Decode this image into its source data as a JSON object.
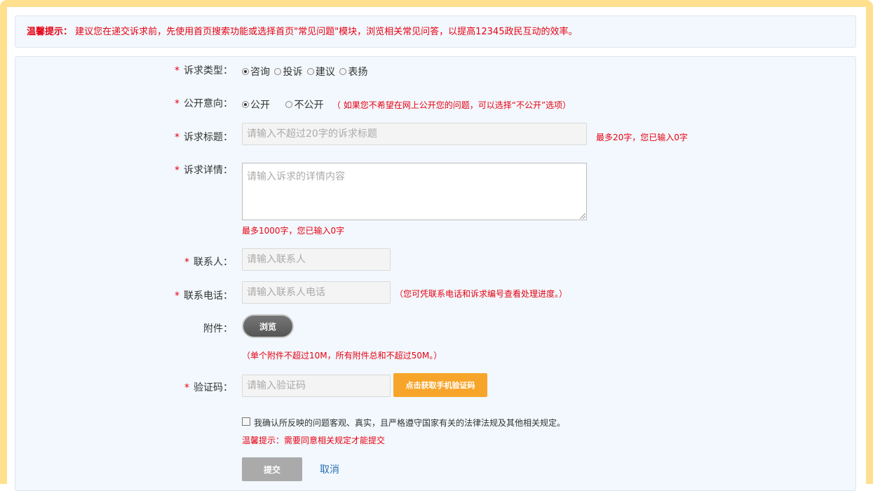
{
  "notice": {
    "label": "温馨提示：",
    "text": "建议您在递交诉求前，先使用首页搜索功能或选择首页\"常见问题\"模块，浏览相关常见问答，以提高12345政民互动的效率。"
  },
  "form": {
    "type": {
      "label": "诉求类型：",
      "options": [
        "咨询",
        "投诉",
        "建议",
        "表扬"
      ],
      "selected": "咨询"
    },
    "public": {
      "label": "公开意向：",
      "options": [
        "公开",
        "不公开"
      ],
      "selected": "公开",
      "hint": "（ 如果您不希望在网上公开您的问题，可以选择“不公开”选项）"
    },
    "title": {
      "label": "诉求标题：",
      "placeholder": "请输入不超过20字的诉求标题",
      "counter": "最多20字，您已输入0字"
    },
    "detail": {
      "label": "诉求详情：",
      "placeholder": "请输入诉求的详情内容",
      "counter": "最多1000字，您已输入0字"
    },
    "contact": {
      "label": "联系人：",
      "placeholder": "请输入联系人"
    },
    "phone": {
      "label": "联系电话：",
      "placeholder": "请输入联系人电话",
      "hint": "（您可凭联系电话和诉求编号查看处理进度。）"
    },
    "attachment": {
      "label": "附件：",
      "button": "浏览",
      "hint": "（单个附件不超过10M，所有附件总和不超过50M。）"
    },
    "captcha": {
      "label": "验证码：",
      "placeholder": "请输入验证码",
      "button": "点击获取手机验证码"
    },
    "agree": {
      "text": "我确认所反映的问题客观、真实，且严格遵守国家有关的法律法规及其他相关规定。",
      "hint": "温馨提示：需要同意相关规定才能提交"
    },
    "submit": "提交",
    "cancel": "取消",
    "required_mark": "*"
  },
  "colors": {
    "border": "#ffe08f",
    "panel": "#f2f8fd",
    "warning": "#e60012",
    "sms_button": "#f7a52a",
    "link": "#2a6fb0"
  }
}
